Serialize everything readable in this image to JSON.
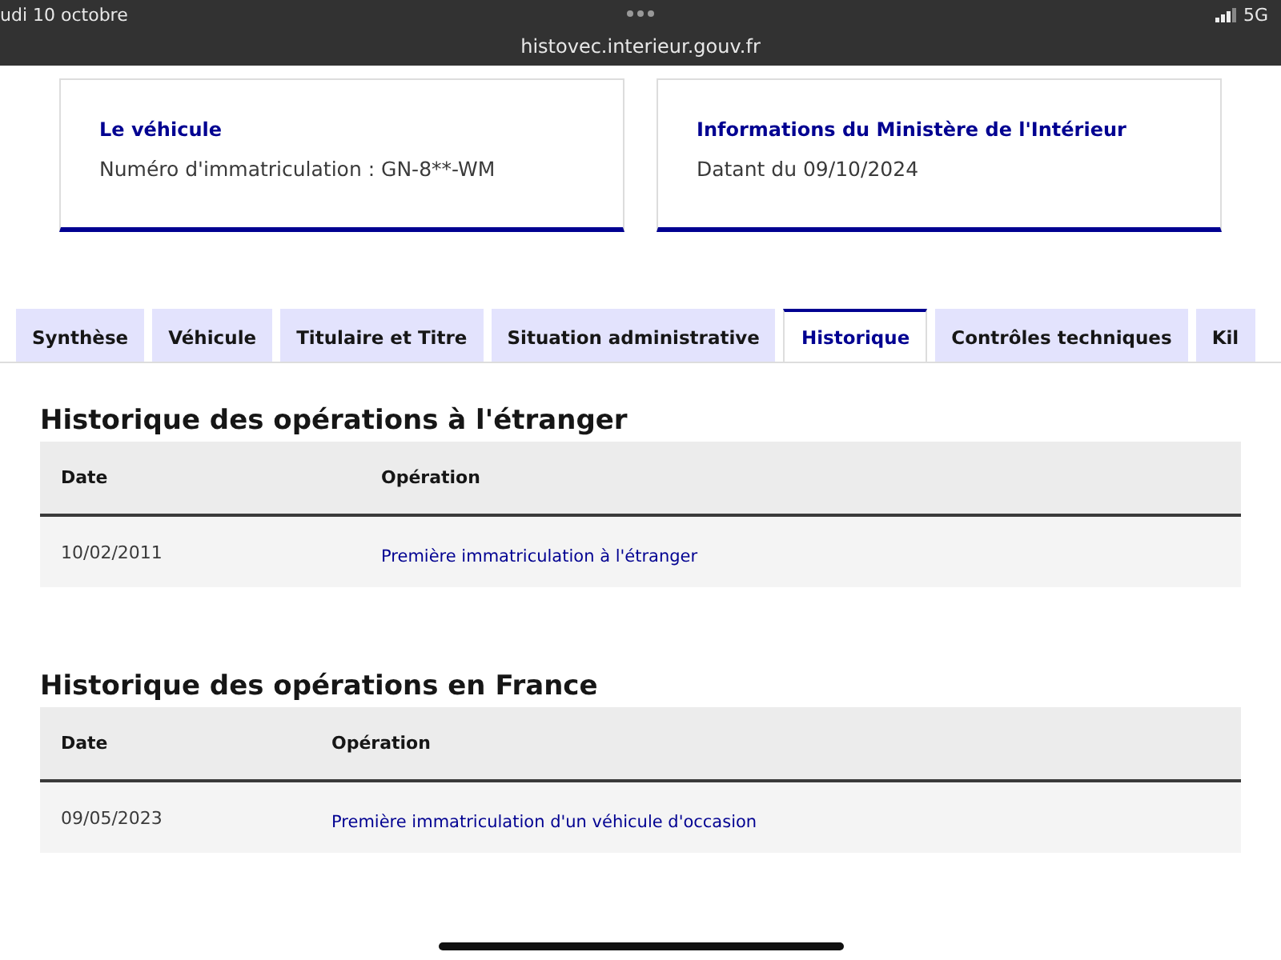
{
  "status_bar": {
    "date": "udi 10 octobre",
    "url": "histovec.interieur.gouv.fr",
    "network": "5G"
  },
  "cards": [
    {
      "title": "Le véhicule",
      "text": "Numéro d'immatriculation : GN-8**-WM"
    },
    {
      "title": "Informations du Ministère de l'Intérieur",
      "text": "Datant du 09/10/2024"
    }
  ],
  "tabs": [
    {
      "label": "Synthèse",
      "selected": false
    },
    {
      "label": "Véhicule",
      "selected": false
    },
    {
      "label": "Titulaire et Titre",
      "selected": false
    },
    {
      "label": "Situation administrative",
      "selected": false
    },
    {
      "label": "Historique",
      "selected": true
    },
    {
      "label": "Contrôles techniques",
      "selected": false
    },
    {
      "label": "Kil",
      "selected": false
    }
  ],
  "sections": [
    {
      "title": "Historique des opérations à l'étranger",
      "columns": [
        "Date",
        "Opération"
      ],
      "rows": [
        [
          "10/02/2011",
          "Première immatriculation à l'étranger"
        ]
      ]
    },
    {
      "title": "Historique des opérations en France",
      "columns": [
        "Date",
        "Opération"
      ],
      "rows": [
        [
          "09/05/2023",
          "Première immatriculation d'un véhicule d'occasion"
        ]
      ]
    }
  ]
}
